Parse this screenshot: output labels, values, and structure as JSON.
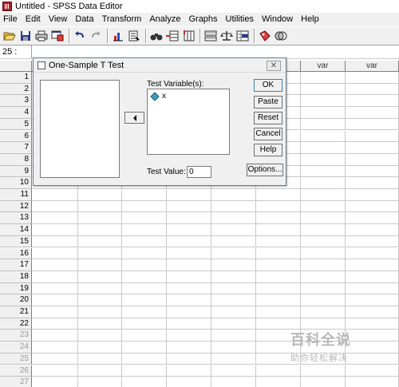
{
  "window": {
    "title": "Untitled - SPSS Data Editor"
  },
  "menu": [
    "File",
    "Edit",
    "View",
    "Data",
    "Transform",
    "Analyze",
    "Graphs",
    "Utilities",
    "Window",
    "Help"
  ],
  "toolbar": {
    "icons": [
      "open-icon",
      "save-icon",
      "print-icon",
      "dialog-recall-icon",
      "undo-icon",
      "redo-icon",
      "goto-chart-icon",
      "goto-case-icon",
      "variables-icon",
      "find-icon",
      "insert-case-icon",
      "insert-variable-icon",
      "split-file-icon",
      "weight-cases-icon",
      "select-cases-icon",
      "value-labels-icon",
      "use-sets-icon"
    ]
  },
  "cell_editor": {
    "reference": "25 :",
    "value": ""
  },
  "grid": {
    "column_headers": [
      "var",
      "var",
      "var",
      "var",
      "var",
      "var",
      "var",
      "var"
    ],
    "rows": [
      "1",
      "2",
      "3",
      "4",
      "5",
      "6",
      "7",
      "8",
      "9",
      "10",
      "11",
      "12",
      "13",
      "14",
      "15",
      "16",
      "17",
      "18",
      "19",
      "20",
      "21",
      "22",
      "23",
      "24",
      "25",
      "26",
      "27"
    ],
    "dimmed_from_row": 23
  },
  "dialog": {
    "title": "One-Sample T Test",
    "close_label": "✕",
    "test_variables_label": "Test Variable(s):",
    "test_variables": [
      "x"
    ],
    "test_value_label": "Test Value:",
    "test_value": "0",
    "buttons": {
      "ok": "OK",
      "paste": "Paste",
      "reset": "Reset",
      "cancel": "Cancel",
      "help": "Help",
      "options": "Options..."
    }
  },
  "watermark": {
    "main": "百科全说",
    "sub": "助你轻松解决"
  }
}
